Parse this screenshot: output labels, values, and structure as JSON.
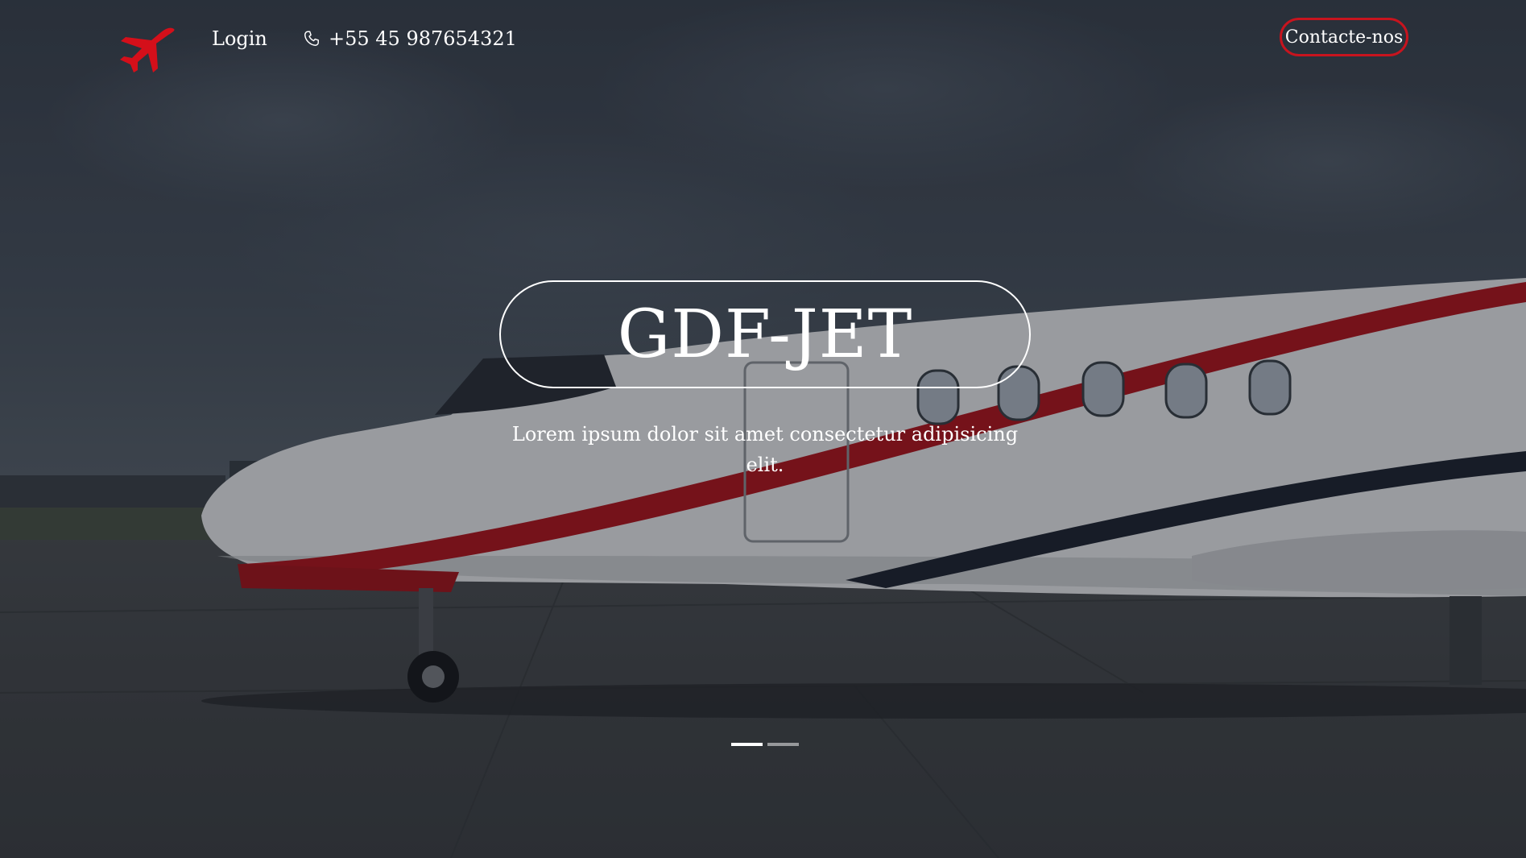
{
  "brand": {
    "logo_icon": "airplane-icon",
    "logo_color": "#d40f1a"
  },
  "nav": {
    "login_label": "Login",
    "phone_icon": "phone-icon",
    "phone_number": "+55 45 987654321",
    "contact_label": "Contacte-nos",
    "contact_border_color": "#c8141e"
  },
  "hero": {
    "title": "GDF-JET",
    "subtitle": "Lorem ipsum dolor sit amet consectetur adipisicing elit."
  },
  "carousel": {
    "slide_count": 2,
    "active_index": 0
  }
}
